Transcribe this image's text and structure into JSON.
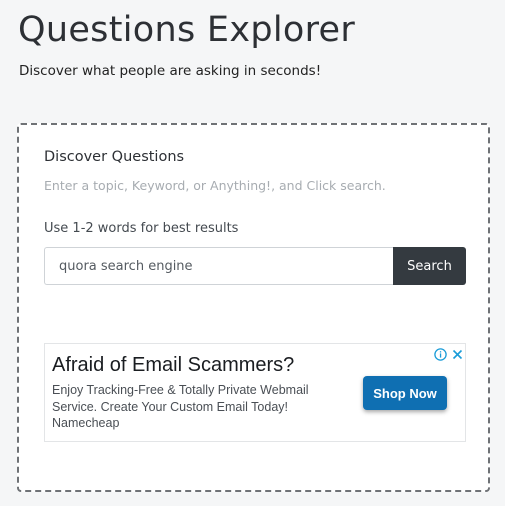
{
  "header": {
    "title": "Questions Explorer",
    "subtitle": "Discover what people are asking in seconds!"
  },
  "panel": {
    "heading": "Discover Questions",
    "hint": "Enter a topic, Keyword, or Anything!, and Click search.",
    "input_label": "Use 1-2 words for best results",
    "search_value": "quora search engine",
    "search_button_label": "Search"
  },
  "ad": {
    "headline": "Afraid of Email Scammers?",
    "body": "Enjoy Tracking-Free & Totally Private Webmail Service. Create Your Custom Email Today!",
    "advertiser": "Namecheap",
    "cta_label": "Shop Now",
    "icons": [
      "info-icon",
      "close-icon"
    ],
    "accent_color": "#0f6fb2"
  },
  "colors": {
    "search_button": "#343a40",
    "panel_border": "#6f7276"
  }
}
